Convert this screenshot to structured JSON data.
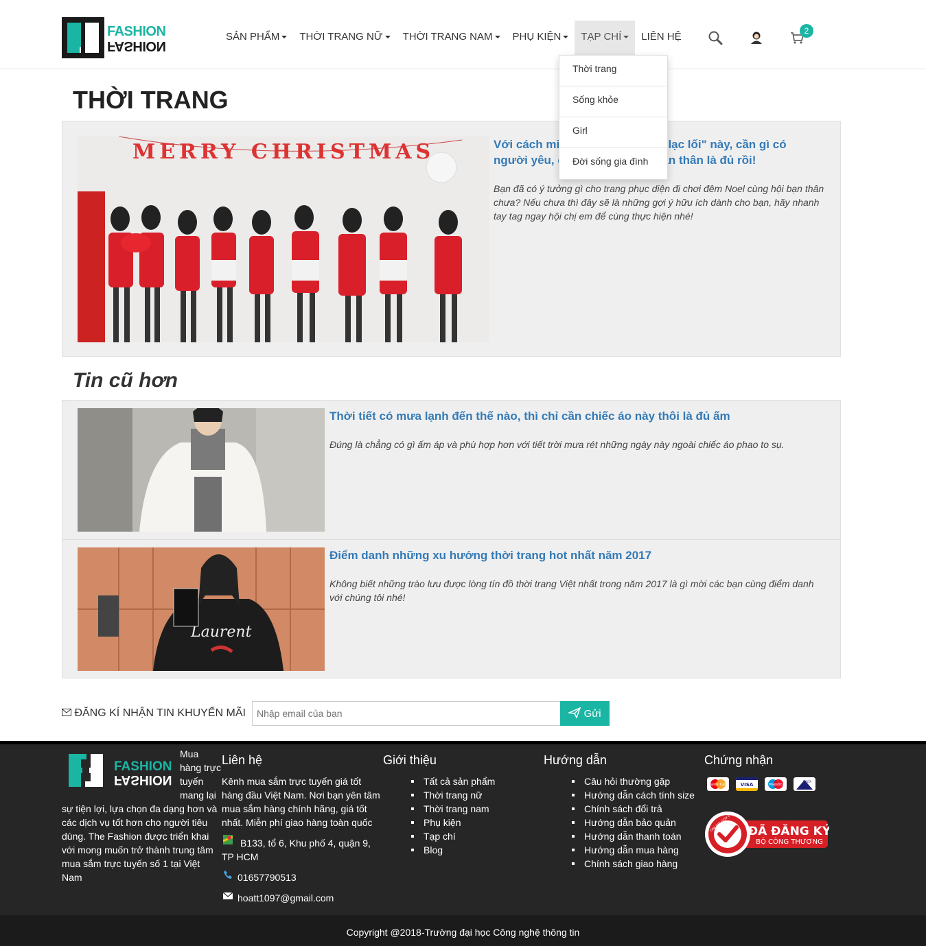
{
  "header": {
    "logo_top": "FASHION",
    "logo_bottom": "FASHION",
    "nav": [
      {
        "label": "SẢN PHẨM",
        "dropdown": true
      },
      {
        "label": "THỜI TRANG NỮ",
        "dropdown": true
      },
      {
        "label": "THỜI TRANG NAM",
        "dropdown": true
      },
      {
        "label": "PHỤ KIỆN",
        "dropdown": true
      },
      {
        "label": "TẠP CHÍ",
        "dropdown": true,
        "active": true
      },
      {
        "label": "LIÊN HỆ",
        "dropdown": false
      }
    ],
    "cart_count": "2",
    "dropdown_items": [
      "Thời trang",
      "Sống khỏe",
      "Girl",
      "Đời sống gia đình"
    ]
  },
  "main": {
    "page_title": "THỜI TRANG",
    "featured": {
      "title": "Với cách mix đồ theo style \"trẻ lạc lối\" này, cần gì có người yêu, cứ diện cùng hội bạn thân là đủ rồi!",
      "description": "Bạn đã có ý tưởng gì cho trang phục diện đi chơi đêm Noel cùng hội bạn thân chưa? Nếu chưa thì đây sẽ là những gợi ý hữu ích dành cho bạn, hãy nhanh tay tag ngay hội chị em để cùng thực hiện nhé!",
      "banner_text": "MERRY CHRISTMAS"
    },
    "older_title": "Tin cũ hơn",
    "articles": [
      {
        "title": "Thời tiết có mưa lạnh đến thế nào, thì chỉ cần chiếc áo này thôi là đủ ấm",
        "description": "Đúng là chẳng có gì ấm áp và phù hợp hơn với tiết trời mưa rét những ngày này ngoài chiếc áo phao to sụ."
      },
      {
        "title": "Điểm danh những xu hướng thời trang hot nhất năm 2017",
        "description": "Không biết những trào lưu được lòng tín đồ thời trang Việt nhất trong năm 2017 là gì mời các bạn cùng điểm danh với chúng tôi nhé!",
        "shirt_text": "Laurent"
      }
    ]
  },
  "subscribe": {
    "label": "ĐĂNG KÍ NHẬN TIN KHUYẾN MÃI",
    "placeholder": "Nhập email của bạn",
    "button": "Gửi"
  },
  "footer": {
    "logo_top": "FASHION",
    "logo_bottom": "FASHION",
    "about_top": "Mua hàng trực tuyến mang lại",
    "about_rest": "sự tiện lợi, lựa chọn đa dạng hơn và các dịch vụ tốt hơn cho người tiêu dùng. The Fashion được triển khai với mong muốn trở thành trung tâm mua sắm trực tuyến số 1 tại Việt Nam",
    "contact": {
      "title": "Liên hệ",
      "intro": "Kênh mua sắm trực tuyến giá tốt hàng đầu Việt Nam. Nơi bạn yên tâm mua sắm hàng chính hãng, giá tốt nhất. Miễn phí giao hàng toàn quốc",
      "address": "B133, tổ 6, Khu phố 4, quận 9, TP HCM",
      "phone": "01657790513",
      "email": "hoatt1097@gmail.com"
    },
    "about_col": {
      "title": "Giới thiệu",
      "links": [
        "Tất cả sản phẩm",
        "Thời trang nữ",
        "Thời trang nam",
        "Phụ kiện",
        "Tạp chí",
        "Blog"
      ]
    },
    "guide": {
      "title": "Hướng dẫn",
      "links": [
        "Câu hỏi thường gặp",
        "Hướng dẫn cách tính size",
        "Chính sách đổi trả",
        "Hướng dẫn bảo quản",
        "Hướng dẫn thanh toán",
        "Hướng dẫn mua hàng",
        "Chính sách giao hàng"
      ]
    },
    "certification": {
      "title": "Chứng nhận",
      "cards": [
        "MasterCard",
        "VISA",
        "Maestro",
        "DELTA"
      ],
      "badge_main": "ĐÃ ĐĂNG KÝ",
      "badge_sub": "BỘ CÔNG THƯƠNG",
      "badge_ring": "ONLINE.GOV.VN"
    },
    "copyright": "Copyright @2018-Trường đại học Công nghệ thông tin"
  },
  "colors": {
    "accent": "#1bb5a3",
    "link": "#337ab7",
    "footer_bg": "#262626"
  }
}
